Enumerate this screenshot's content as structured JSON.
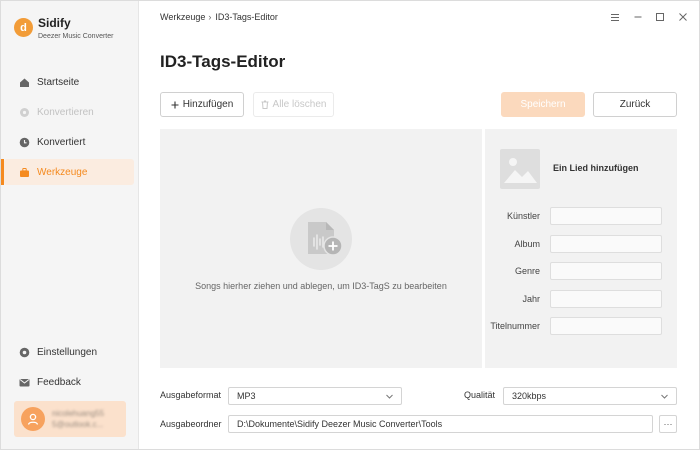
{
  "app": {
    "name": "Sidify",
    "subtitle": "Deezer Music Converter",
    "logo_letter": "d",
    "accent_color": "#f58a1f"
  },
  "sidebar": {
    "items": [
      {
        "label": "Startseite",
        "icon": "home-icon",
        "state": "normal"
      },
      {
        "label": "Konvertieren",
        "icon": "convert-icon",
        "state": "disabled"
      },
      {
        "label": "Konvertiert",
        "icon": "clock-icon",
        "state": "normal"
      },
      {
        "label": "Werkzeuge",
        "icon": "toolbox-icon",
        "state": "active"
      }
    ],
    "bottom_items": [
      {
        "label": "Einstellungen",
        "icon": "gear-icon"
      },
      {
        "label": "Feedback",
        "icon": "mail-icon"
      }
    ],
    "user": {
      "line1": "nicolehuang55",
      "line2": "5@outlook.c..."
    }
  },
  "breadcrumb": {
    "parent": "Werkzeuge",
    "separator": "›",
    "current": "ID3-Tags-Editor"
  },
  "page": {
    "title": "ID3-Tags-Editor"
  },
  "toolbar": {
    "add_label": "Hinzufügen",
    "clear_label": "Alle löschen",
    "save_label": "Speichern",
    "back_label": "Zurück"
  },
  "dropzone": {
    "text": "Songs hierher ziehen und ablegen, um ID3-TagS zu bearbeiten"
  },
  "tag_panel": {
    "add_song_label": "Ein Lied hinzufügen",
    "fields": [
      {
        "label": "Künstler",
        "value": ""
      },
      {
        "label": "Album",
        "value": ""
      },
      {
        "label": "Genre",
        "value": ""
      },
      {
        "label": "Jahr",
        "value": ""
      },
      {
        "label": "Titelnummer",
        "value": ""
      }
    ]
  },
  "output": {
    "format_label": "Ausgabeformat",
    "format_value": "MP3",
    "quality_label": "Qualität",
    "quality_value": "320kbps",
    "folder_label": "Ausgabeordner",
    "folder_value": "D:\\Dokumente\\Sidify Deezer Music Converter\\Tools",
    "browse_label": "···"
  }
}
